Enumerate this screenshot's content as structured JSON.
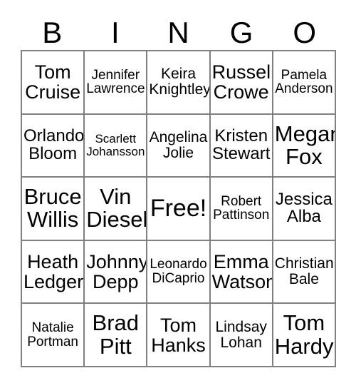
{
  "card": {
    "title": "BINGO",
    "header_letters": [
      "B",
      "I",
      "N",
      "G",
      "O"
    ],
    "free_space_label": "Free!",
    "colors": {
      "background": "#ffffff",
      "text": "#000000",
      "grid_line": "#808080"
    },
    "grid": {
      "columns": 5,
      "rows": 5,
      "cells": [
        [
          {
            "name": "Tom Cruise",
            "line1": "Tom",
            "line2": "Cruise",
            "size": "xl"
          },
          {
            "name": "Jennifer Lawrence",
            "line1": "Jennifer",
            "line2": "Lawrence",
            "size": "sm"
          },
          {
            "name": "Keira Knightley",
            "line1": "Keira",
            "line2": "Knightley",
            "size": "md"
          },
          {
            "name": "Russell Crowe",
            "line1": "Russell",
            "line2": "Crowe",
            "size": "xl"
          },
          {
            "name": "Pamela Anderson",
            "line1": "Pamela",
            "line2": "Anderson",
            "size": "sm"
          }
        ],
        [
          {
            "name": "Orlando Bloom",
            "line1": "Orlando",
            "line2": "Bloom",
            "size": "lg"
          },
          {
            "name": "Scarlett Johansson",
            "line1": "Scarlett",
            "line2": "Johansson",
            "size": "xs"
          },
          {
            "name": "Angelina Jolie",
            "line1": "Angelina",
            "line2": "Jolie",
            "size": "md"
          },
          {
            "name": "Kristen Stewart",
            "line1": "Kristen",
            "line2": "Stewart",
            "size": "lg"
          },
          {
            "name": "Megan Fox",
            "line1": "Megan",
            "line2": "Fox",
            "size": "xxl"
          }
        ],
        [
          {
            "name": "Bruce Willis",
            "line1": "Bruce",
            "line2": "Willis",
            "size": "xxl"
          },
          {
            "name": "Vin Diesel",
            "line1": "Vin",
            "line2": "Diesel",
            "size": "xxl"
          },
          {
            "name": "Free!",
            "line1": "Free!",
            "line2": "",
            "size": "free",
            "free_space": true
          },
          {
            "name": "Robert Pattinson",
            "line1": "Robert",
            "line2": "Pattinson",
            "size": "sm"
          },
          {
            "name": "Jessica Alba",
            "line1": "Jessica",
            "line2": "Alba",
            "size": "lg"
          }
        ],
        [
          {
            "name": "Heath Ledger",
            "line1": "Heath",
            "line2": "Ledger",
            "size": "xl"
          },
          {
            "name": "Johnny Depp",
            "line1": "Johnny",
            "line2": "Depp",
            "size": "xl"
          },
          {
            "name": "Leonardo DiCaprio",
            "line1": "Leonardo",
            "line2": "DiCaprio",
            "size": "sm"
          },
          {
            "name": "Emma Watson",
            "line1": "Emma",
            "line2": "Watson",
            "size": "xl"
          },
          {
            "name": "Christian Bale",
            "line1": "Christian",
            "line2": "Bale",
            "size": "md"
          }
        ],
        [
          {
            "name": "Natalie Portman",
            "line1": "Natalie",
            "line2": "Portman",
            "size": "sm"
          },
          {
            "name": "Brad Pitt",
            "line1": "Brad",
            "line2": "Pitt",
            "size": "xxl"
          },
          {
            "name": "Tom Hanks",
            "line1": "Tom",
            "line2": "Hanks",
            "size": "xl"
          },
          {
            "name": "Lindsay Lohan",
            "line1": "Lindsay",
            "line2": "Lohan",
            "size": "md"
          },
          {
            "name": "Tom Hardy",
            "line1": "Tom",
            "line2": "Hardy",
            "size": "xxl"
          }
        ]
      ]
    }
  }
}
